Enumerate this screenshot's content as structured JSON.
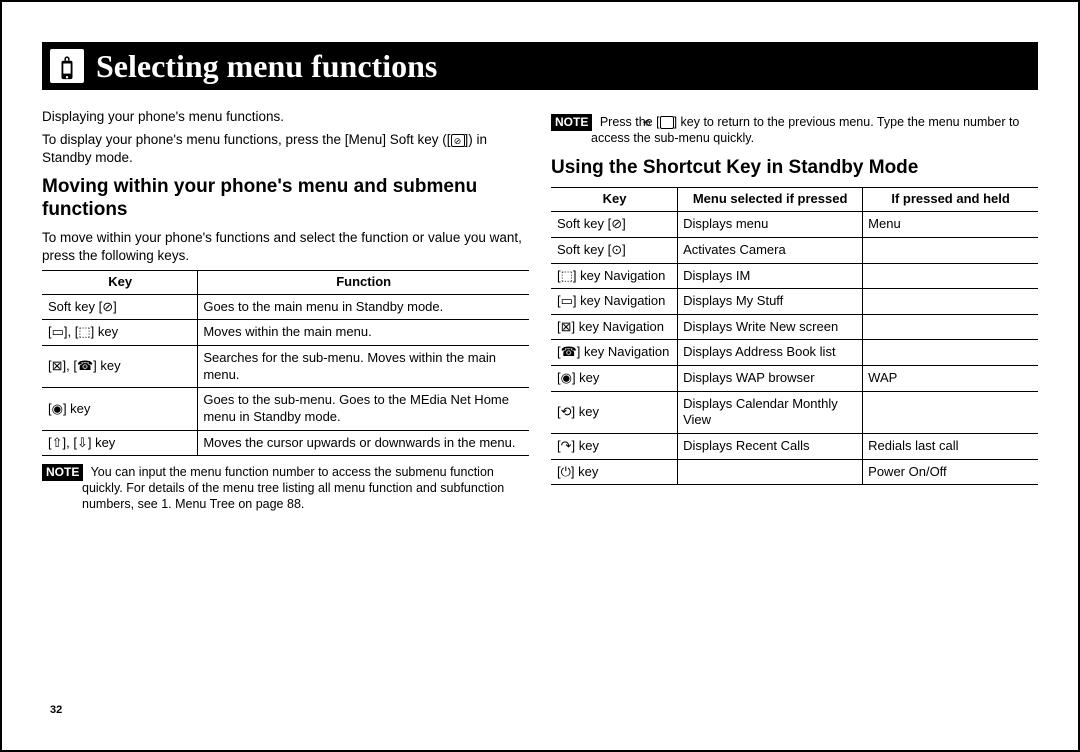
{
  "titleBar": {
    "title": "Selecting menu functions"
  },
  "leftCol": {
    "intro1": "Displaying your phone's menu functions.",
    "intro2a": "To display your phone's menu functions, press the [Menu] Soft key ([",
    "intro2b": "]) in Standby mode.",
    "heading1": "Moving within your phone's menu and submenu functions",
    "movingIntro": "To move within your phone's functions and select the function or value you want, press the following keys.",
    "table1": {
      "headers": [
        "Key",
        "Function"
      ],
      "rows": [
        {
          "k": "Soft key [⊘]",
          "f": "Goes to the main menu in Standby mode."
        },
        {
          "k": "[▭], [⬚] key",
          "f": "Moves within the main menu."
        },
        {
          "k": "[⊠], [☎] key",
          "f": "Searches for the sub-menu. Moves within the main menu."
        },
        {
          "k": "[◉] key",
          "f": "Goes to the sub-menu. Goes to the MEdia Net Home menu in Standby mode."
        },
        {
          "k": "[⇧], [⇩] key",
          "f": "Moves the cursor upwards or downwards in the menu."
        }
      ]
    },
    "note1": "You can input the menu function number to access the submenu function quickly. For details of the menu tree listing all menu function and subfunction numbers, see 1. Menu Tree on page 88."
  },
  "rightCol": {
    "note2a": "Press the [",
    "note2b": "] key to return to the previous menu. Type the menu number to access the sub-menu quickly.",
    "heading2": "Using the Shortcut Key in Standby Mode",
    "table2": {
      "headers": [
        "Key",
        "Menu selected if pressed",
        "If pressed and held"
      ],
      "rows": [
        {
          "k": "Soft key [⊘]",
          "p": "Displays menu",
          "h": "Menu"
        },
        {
          "k": "Soft key [⊙]",
          "p": "Activates Camera",
          "h": ""
        },
        {
          "k": "[⬚] key Navigation",
          "p": "Displays IM",
          "h": ""
        },
        {
          "k": "[▭] key Navigation",
          "p": "Displays My Stuff",
          "h": ""
        },
        {
          "k": "[⊠] key Navigation",
          "p": "Displays Write New screen",
          "h": ""
        },
        {
          "k": "[☎] key Navigation",
          "p": "Displays Address Book list",
          "h": ""
        },
        {
          "k": "[◉] key",
          "p": "Displays WAP browser",
          "h": "WAP"
        },
        {
          "k": "[⟲] key",
          "p": "Displays Calendar Monthly View",
          "h": ""
        },
        {
          "k": "[↷] key",
          "p": "Displays Recent Calls",
          "h": "Redials last call"
        },
        {
          "k": "[⏻] key",
          "p": "",
          "h": "Power On/Off"
        }
      ]
    }
  },
  "pageNumber": "32",
  "noteLabel": "NOTE"
}
